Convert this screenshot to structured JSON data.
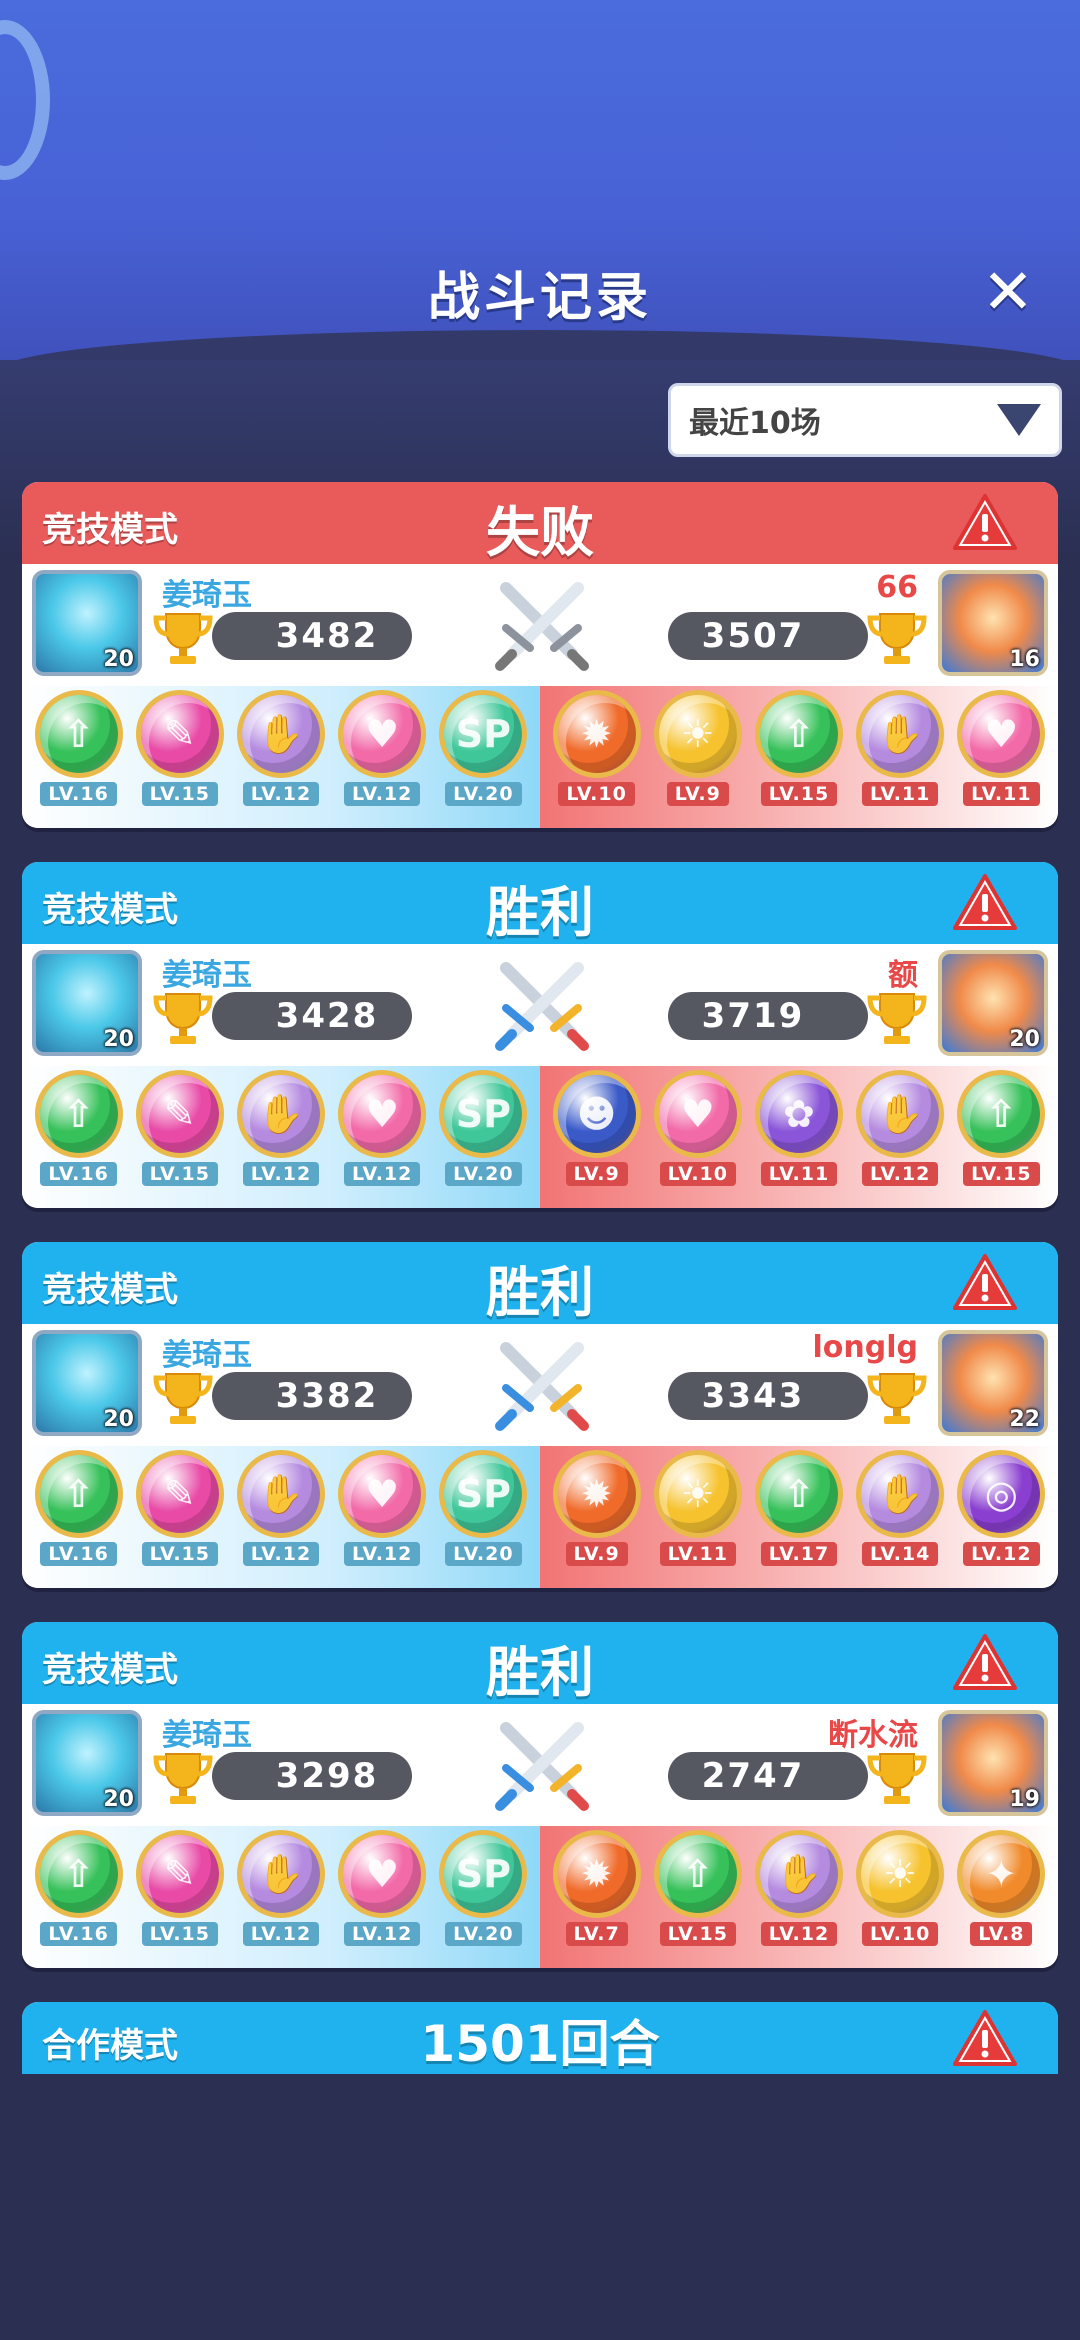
{
  "title": "战斗记录",
  "filter": {
    "selected": "最近10场"
  },
  "colors": {
    "lose": "#e95a5a",
    "win": "#1fb2ee",
    "bg": "#2b2f52"
  },
  "matches": [
    {
      "mode": "竞技模式",
      "result": "失败",
      "outcome": "lose",
      "left": {
        "name": "姜琦玉",
        "score": "3482",
        "level": "20",
        "heroes": [
          {
            "lv": "LV.16",
            "icon": "green-arrow",
            "color": "#37c15a"
          },
          {
            "lv": "LV.15",
            "icon": "feather",
            "color": "#e84aa6"
          },
          {
            "lv": "LV.12",
            "icon": "hands",
            "color": "#b58be0"
          },
          {
            "lv": "LV.12",
            "icon": "heart",
            "color": "#f26aa8"
          },
          {
            "lv": "LV.20",
            "icon": "sp",
            "color": "#3fc79a"
          }
        ]
      },
      "right": {
        "name": "66",
        "score": "3507",
        "level": "16",
        "heroes": [
          {
            "lv": "LV.10",
            "icon": "flame",
            "color": "#f06a2a"
          },
          {
            "lv": "LV.9",
            "icon": "sun",
            "color": "#f6c22e"
          },
          {
            "lv": "LV.15",
            "icon": "green-arrow",
            "color": "#37c15a"
          },
          {
            "lv": "LV.11",
            "icon": "hands",
            "color": "#b58be0"
          },
          {
            "lv": "LV.11",
            "icon": "heart",
            "color": "#f26aa8"
          }
        ]
      }
    },
    {
      "mode": "竞技模式",
      "result": "胜利",
      "outcome": "win",
      "left": {
        "name": "姜琦玉",
        "score": "3428",
        "level": "20",
        "heroes": [
          {
            "lv": "LV.16",
            "icon": "green-arrow",
            "color": "#37c15a"
          },
          {
            "lv": "LV.15",
            "icon": "feather",
            "color": "#e84aa6"
          },
          {
            "lv": "LV.12",
            "icon": "hands",
            "color": "#b58be0"
          },
          {
            "lv": "LV.12",
            "icon": "heart",
            "color": "#f26aa8"
          },
          {
            "lv": "LV.20",
            "icon": "sp",
            "color": "#3fc79a"
          }
        ]
      },
      "right": {
        "name": "额",
        "score": "3719",
        "level": "20",
        "heroes": [
          {
            "lv": "LV.9",
            "icon": "mask",
            "color": "#3a5ac8"
          },
          {
            "lv": "LV.10",
            "icon": "heart",
            "color": "#f26aa8"
          },
          {
            "lv": "LV.11",
            "icon": "butterfly",
            "color": "#8a55d8"
          },
          {
            "lv": "LV.12",
            "icon": "hands",
            "color": "#b58be0"
          },
          {
            "lv": "LV.15",
            "icon": "green-arrow",
            "color": "#37c15a"
          }
        ]
      }
    },
    {
      "mode": "竞技模式",
      "result": "胜利",
      "outcome": "win",
      "left": {
        "name": "姜琦玉",
        "score": "3382",
        "level": "20",
        "heroes": [
          {
            "lv": "LV.16",
            "icon": "green-arrow",
            "color": "#37c15a"
          },
          {
            "lv": "LV.15",
            "icon": "feather",
            "color": "#e84aa6"
          },
          {
            "lv": "LV.12",
            "icon": "hands",
            "color": "#b58be0"
          },
          {
            "lv": "LV.12",
            "icon": "heart",
            "color": "#f26aa8"
          },
          {
            "lv": "LV.20",
            "icon": "sp",
            "color": "#3fc79a"
          }
        ]
      },
      "right": {
        "name": "longlg",
        "score": "3343",
        "level": "22",
        "heroes": [
          {
            "lv": "LV.9",
            "icon": "flame",
            "color": "#f06a2a"
          },
          {
            "lv": "LV.11",
            "icon": "sun",
            "color": "#f6c22e"
          },
          {
            "lv": "LV.17",
            "icon": "green-arrow",
            "color": "#37c15a"
          },
          {
            "lv": "LV.14",
            "icon": "hands",
            "color": "#b58be0"
          },
          {
            "lv": "LV.12",
            "icon": "swirl",
            "color": "#8a3fd0"
          }
        ]
      }
    },
    {
      "mode": "竞技模式",
      "result": "胜利",
      "outcome": "win",
      "left": {
        "name": "姜琦玉",
        "score": "3298",
        "level": "20",
        "heroes": [
          {
            "lv": "LV.16",
            "icon": "green-arrow",
            "color": "#37c15a"
          },
          {
            "lv": "LV.15",
            "icon": "feather",
            "color": "#e84aa6"
          },
          {
            "lv": "LV.12",
            "icon": "hands",
            "color": "#b58be0"
          },
          {
            "lv": "LV.12",
            "icon": "heart",
            "color": "#f26aa8"
          },
          {
            "lv": "LV.20",
            "icon": "sp",
            "color": "#3fc79a"
          }
        ]
      },
      "right": {
        "name": "断水流",
        "score": "2747",
        "level": "19",
        "heroes": [
          {
            "lv": "LV.7",
            "icon": "flame",
            "color": "#f06a2a"
          },
          {
            "lv": "LV.15",
            "icon": "green-arrow",
            "color": "#37c15a"
          },
          {
            "lv": "LV.12",
            "icon": "hands",
            "color": "#b58be0"
          },
          {
            "lv": "LV.10",
            "icon": "sun",
            "color": "#f6c22e"
          },
          {
            "lv": "LV.8",
            "icon": "star-burst",
            "color": "#f08a2a"
          }
        ]
      }
    }
  ],
  "coop": {
    "mode": "合作模式",
    "result": "1501回合",
    "outcome": "win"
  }
}
